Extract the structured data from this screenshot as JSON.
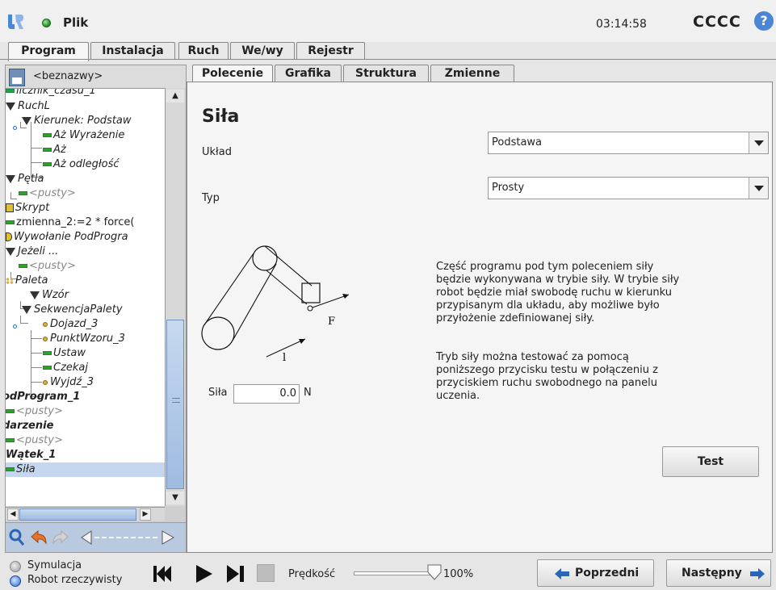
{
  "header": {
    "app_title": "Plik",
    "clock": "03:14:58",
    "robot_name": "CCCC",
    "help_label": "?"
  },
  "main_tabs": [
    "Program",
    "Instalacja",
    "Ruch",
    "We/wy",
    "Rejestr"
  ],
  "active_main_tab": "Program",
  "left_panel": {
    "file_name": "<beznazwy>",
    "tree": [
      {
        "label": "licznik_czasu_1",
        "icon": "assign-icon"
      },
      {
        "label": "RuchL",
        "icon": "move-icon"
      },
      {
        "label": "Kierunek: Podstaw",
        "icon": "direction-icon"
      },
      {
        "label": "Aż Wyrażenie",
        "icon": "until-icon"
      },
      {
        "label": "Aż",
        "icon": "until-icon"
      },
      {
        "label": "Aż odległość",
        "icon": "until-icon"
      },
      {
        "label": "Pętla",
        "icon": "loop-icon"
      },
      {
        "label": "<pusty>",
        "icon": "empty-icon"
      },
      {
        "label": "Skrypt",
        "icon": "script-icon"
      },
      {
        "label": "zmienna_2:=2 * force(",
        "icon": "assign-icon"
      },
      {
        "label": "Wywołanie PodProgra",
        "icon": "call-icon"
      },
      {
        "label": "Jeżeli ...",
        "icon": "if-icon"
      },
      {
        "label": "<pusty>",
        "icon": "empty-icon"
      },
      {
        "label": "Paleta",
        "icon": "pallet-icon"
      },
      {
        "label": "Wzór",
        "icon": "pattern-icon"
      },
      {
        "label": "SekwencjaPalety",
        "icon": "sequence-icon"
      },
      {
        "label": "Dojazd_3",
        "icon": "waypoint-icon"
      },
      {
        "label": "PunktWzoru_3",
        "icon": "waypoint-icon"
      },
      {
        "label": "Ustaw",
        "icon": "set-icon"
      },
      {
        "label": "Czekaj",
        "icon": "wait-icon"
      },
      {
        "label": "Wyjdź_3",
        "icon": "waypoint-icon"
      },
      {
        "label": "odProgram_1",
        "icon": "subprogram-icon"
      },
      {
        "label": "<pusty>",
        "icon": "empty-icon"
      },
      {
        "label": "darzenie",
        "icon": "event-icon"
      },
      {
        "label": "<pusty>",
        "icon": "empty-icon"
      },
      {
        "label": "Wątek_1",
        "icon": "thread-icon"
      },
      {
        "label": "Siła",
        "icon": "force-icon"
      }
    ]
  },
  "sub_tabs": [
    "Polecenie",
    "Grafika",
    "Struktura",
    "Zmienne"
  ],
  "active_sub_tab": "Polecenie",
  "command": {
    "title": "Siła",
    "frame_label": "Układ",
    "frame_value": "Podstawa",
    "type_label": "Typ",
    "type_value": "Prosty",
    "diagram_force_label": "F",
    "diagram_length_label": "l",
    "force_label": "Siła",
    "force_value": "0.0",
    "force_unit": "N",
    "description_1": [
      "Część programu pod tym poleceniem siły",
      "będzie wykonywana w trybie siły. W trybie siły",
      "robot będzie miał swobodę ruchu w kierunku",
      "przypisanym dla układu, aby możliwe było",
      "przyłożenie zdefiniowanej siły."
    ],
    "description_2": [
      "Tryb siły można testować za pomocą",
      "poniższego przycisku testu w połączeniu z",
      "przyciskiem ruchu swobodnego na panelu",
      "uczenia."
    ],
    "test_button": "Test"
  },
  "footer": {
    "simulation_label": "Symulacja",
    "real_robot_label": "Robot rzeczywisty",
    "speed_label": "Prędkość",
    "speed_value": "100%",
    "speed_fraction": 1.0,
    "previous_label": "Poprzedni",
    "next_label": "Następny"
  },
  "colors": {
    "accent_blue": "#4a86d6",
    "status_green": "#1e8a1e",
    "tree_green": "#2ba32b"
  }
}
